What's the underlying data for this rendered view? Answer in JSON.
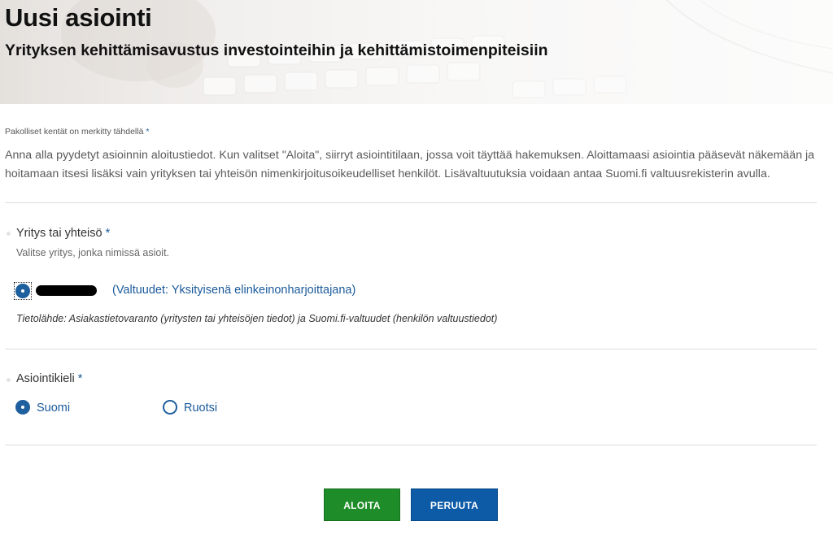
{
  "header": {
    "title": "Uusi asiointi",
    "subtitle": "Yrityksen kehittämisavustus investointeihin ja kehittämistoimenpiteisiin"
  },
  "form": {
    "required_note": "Pakolliset kentät on merkitty tähdellä",
    "required_star": "*",
    "intro": "Anna alla pyydetyt asioinnin aloitustiedot. Kun valitset \"Aloita\", siirryt asiointitilaan, jossa voit täyttää hakemuksen. Aloittamaasi asiointia pääsevät näkemään ja hoitamaan itsesi lisäksi vain yrityksen tai yhteisön nimenkirjoitusoikeudelliset henkilöt. Lisävaltuutuksia voidaan antaa Suomi.fi valtuusrekisterin avulla.",
    "company": {
      "label": "Yritys tai yhteisö",
      "help": "Valitse yritys, jonka nimissä asioit.",
      "option_authorization": "(Valtuudet: Yksityisenä elinkeinonharjoittajana)",
      "option_selected": true,
      "source": "Tietolähde: Asiakastietovaranto (yritysten tai yhteisöjen tiedot) ja Suomi.fi-valtuudet (henkilön valtuustiedot)"
    },
    "language": {
      "label": "Asiointikieli",
      "options": [
        {
          "label": "Suomi",
          "selected": true
        },
        {
          "label": "Ruotsi",
          "selected": false
        }
      ]
    }
  },
  "actions": {
    "start_label": "ALOITA",
    "cancel_label": "PERUUTA"
  },
  "colors": {
    "start_button": "#1e8c28",
    "cancel_button": "#0d5aa7",
    "link_text": "#1a5a9a"
  }
}
